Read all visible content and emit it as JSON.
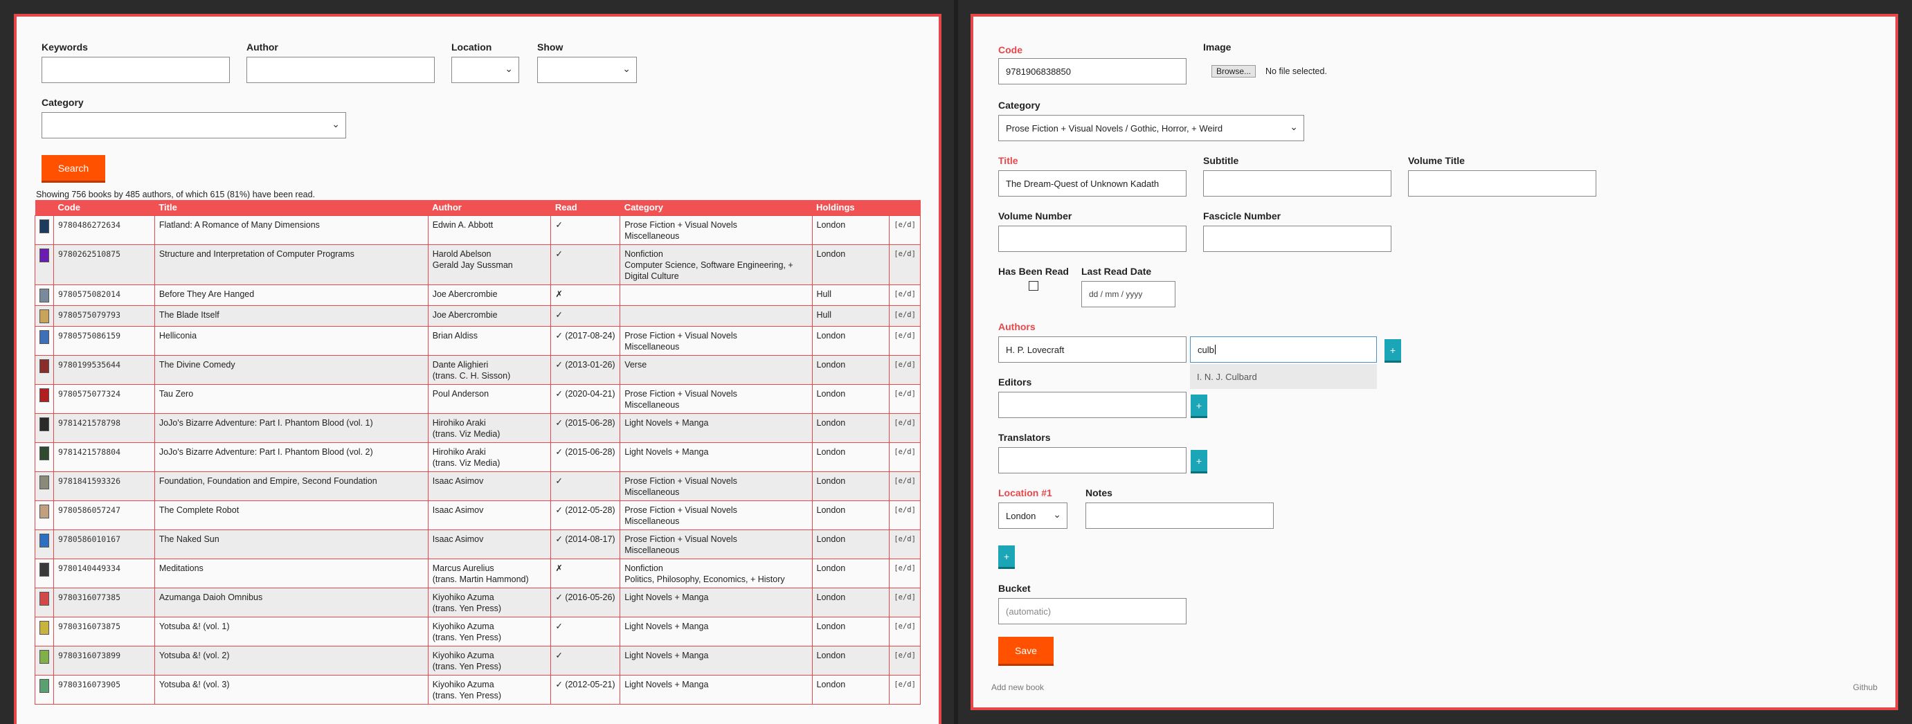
{
  "search": {
    "keywords_label": "Keywords",
    "author_label": "Author",
    "location_label": "Location",
    "show_label": "Show",
    "category_label": "Category",
    "search_button": "Search",
    "summary": "Showing 756 books by 485 authors, of which 615 (81%) have been read."
  },
  "table": {
    "headers": [
      "",
      "Code",
      "Title",
      "Author",
      "Read",
      "Category",
      "Holdings",
      ""
    ],
    "rows": [
      {
        "code": "9780486272634",
        "title": "Flatland: A Romance of Many Dimensions",
        "author": [
          "Edwin A. Abbott"
        ],
        "read": "✓",
        "category": [
          "Prose Fiction + Visual Novels",
          "Miscellaneous"
        ],
        "holdings": "London",
        "edit": "[e/d]",
        "thumb": "#1e3a5f"
      },
      {
        "code": "9780262510875",
        "title": "Structure and Interpretation of Computer Programs",
        "author": [
          "Harold Abelson",
          "Gerald Jay Sussman"
        ],
        "read": "✓",
        "category": [
          "Nonfiction",
          "Computer Science, Software Engineering, +",
          "Digital Culture"
        ],
        "holdings": "London",
        "edit": "[e/d]",
        "thumb": "#6a1bb0"
      },
      {
        "code": "9780575082014",
        "title": "Before They Are Hanged",
        "author": [
          "Joe Abercrombie"
        ],
        "read": "✗",
        "category": [],
        "holdings": "Hull",
        "edit": "[e/d]",
        "thumb": "#7a8a9a"
      },
      {
        "code": "9780575079793",
        "title": "The Blade Itself",
        "author": [
          "Joe Abercrombie"
        ],
        "read": "✓",
        "category": [],
        "holdings": "Hull",
        "edit": "[e/d]",
        "thumb": "#c7a45a"
      },
      {
        "code": "9780575086159",
        "title": "Helliconia",
        "author": [
          "Brian Aldiss"
        ],
        "read": "✓ (2017-08-24)",
        "category": [
          "Prose Fiction + Visual Novels",
          "Miscellaneous"
        ],
        "holdings": "London",
        "edit": "[e/d]",
        "thumb": "#3f6fb5"
      },
      {
        "code": "9780199535644",
        "title": "The Divine Comedy",
        "author": [
          "Dante Alighieri",
          "(trans. C. H. Sisson)"
        ],
        "read": "✓ (2013-01-26)",
        "category": [
          "Verse"
        ],
        "holdings": "London",
        "edit": "[e/d]",
        "thumb": "#8b2c2c"
      },
      {
        "code": "9780575077324",
        "title": "Tau Zero",
        "author": [
          "Poul Anderson"
        ],
        "read": "✓ (2020-04-21)",
        "category": [
          "Prose Fiction + Visual Novels",
          "Miscellaneous"
        ],
        "holdings": "London",
        "edit": "[e/d]",
        "thumb": "#b02020"
      },
      {
        "code": "9781421578798",
        "title": "JoJo's Bizarre Adventure: Part I. Phantom Blood (vol. 1)",
        "author": [
          "Hirohiko Araki",
          "(trans. Viz Media)"
        ],
        "read": "✓ (2015-06-28)",
        "category": [
          "Light Novels + Manga"
        ],
        "holdings": "London",
        "edit": "[e/d]",
        "thumb": "#2a2a2a"
      },
      {
        "code": "9781421578804",
        "title": "JoJo's Bizarre Adventure: Part I. Phantom Blood (vol. 2)",
        "author": [
          "Hirohiko Araki",
          "(trans. Viz Media)"
        ],
        "read": "✓ (2015-06-28)",
        "category": [
          "Light Novels + Manga"
        ],
        "holdings": "London",
        "edit": "[e/d]",
        "thumb": "#2f4a2f"
      },
      {
        "code": "9781841593326",
        "title": "Foundation, Foundation and Empire, Second Foundation",
        "author": [
          "Isaac Asimov"
        ],
        "read": "✓",
        "category": [
          "Prose Fiction + Visual Novels",
          "Miscellaneous"
        ],
        "holdings": "London",
        "edit": "[e/d]",
        "thumb": "#8a8a7a"
      },
      {
        "code": "9780586057247",
        "title": "The Complete Robot",
        "author": [
          "Isaac Asimov"
        ],
        "read": "✓ (2012-05-28)",
        "category": [
          "Prose Fiction + Visual Novels",
          "Miscellaneous"
        ],
        "holdings": "London",
        "edit": "[e/d]",
        "thumb": "#c0a080"
      },
      {
        "code": "9780586010167",
        "title": "The Naked Sun",
        "author": [
          "Isaac Asimov"
        ],
        "read": "✓ (2014-08-17)",
        "category": [
          "Prose Fiction + Visual Novels",
          "Miscellaneous"
        ],
        "holdings": "London",
        "edit": "[e/d]",
        "thumb": "#2f6fc0"
      },
      {
        "code": "9780140449334",
        "title": "Meditations",
        "author": [
          "Marcus Aurelius",
          "(trans. Martin Hammond)"
        ],
        "read": "✗",
        "category": [
          "Nonfiction",
          "Politics, Philosophy, Economics, + History"
        ],
        "holdings": "London",
        "edit": "[e/d]",
        "thumb": "#3a3a3a"
      },
      {
        "code": "9780316077385",
        "title": "Azumanga Daioh Omnibus",
        "author": [
          "Kiyohiko Azuma",
          "(trans. Yen Press)"
        ],
        "read": "✓ (2016-05-26)",
        "category": [
          "Light Novels + Manga"
        ],
        "holdings": "London",
        "edit": "[e/d]",
        "thumb": "#d04a4a"
      },
      {
        "code": "9780316073875",
        "title": "Yotsuba &! (vol. 1)",
        "author": [
          "Kiyohiko Azuma",
          "(trans. Yen Press)"
        ],
        "read": "✓",
        "category": [
          "Light Novels + Manga"
        ],
        "holdings": "London",
        "edit": "[e/d]",
        "thumb": "#c9b340"
      },
      {
        "code": "9780316073899",
        "title": "Yotsuba &! (vol. 2)",
        "author": [
          "Kiyohiko Azuma",
          "(trans. Yen Press)"
        ],
        "read": "✓",
        "category": [
          "Light Novels + Manga"
        ],
        "holdings": "London",
        "edit": "[e/d]",
        "thumb": "#7fb04a"
      },
      {
        "code": "9780316073905",
        "title": "Yotsuba &! (vol. 3)",
        "author": [
          "Kiyohiko Azuma",
          "(trans. Yen Press)"
        ],
        "read": "✓ (2012-05-21)",
        "category": [
          "Light Novels + Manga"
        ],
        "holdings": "London",
        "edit": "[e/d]",
        "thumb": "#5aa070"
      }
    ]
  },
  "form": {
    "code_label": "Code",
    "code_value": "9781906838850",
    "image_label": "Image",
    "browse_button": "Browse...",
    "file_status": "No file selected.",
    "category_label": "Category",
    "category_value": "Prose Fiction + Visual Novels / Gothic, Horror, + Weird",
    "title_label": "Title",
    "title_value": "The Dream-Quest of Unknown Kadath",
    "subtitle_label": "Subtitle",
    "volume_title_label": "Volume Title",
    "volume_number_label": "Volume Number",
    "fascicle_number_label": "Fascicle Number",
    "has_been_read_label": "Has Been Read",
    "last_read_date_label": "Last Read Date",
    "last_read_date_placeholder": "dd / mm / yyyy",
    "authors_label": "Authors",
    "author_1_value": "H. P. Lovecraft",
    "author_2_value": "culb",
    "author_suggestion": "I. N. J. Culbard",
    "editors_label": "Editors",
    "translators_label": "Translators",
    "location_label": "Location #1",
    "location_value": "London",
    "notes_label": "Notes",
    "bucket_label": "Bucket",
    "bucket_placeholder": "(automatic)",
    "save_button": "Save",
    "plus": "+"
  },
  "footer": {
    "add_new_book": "Add new book",
    "github": "Github"
  },
  "colors": {
    "accent": "#e5474b",
    "button": "#ff5100",
    "plus_button": "#1aa6b7"
  }
}
